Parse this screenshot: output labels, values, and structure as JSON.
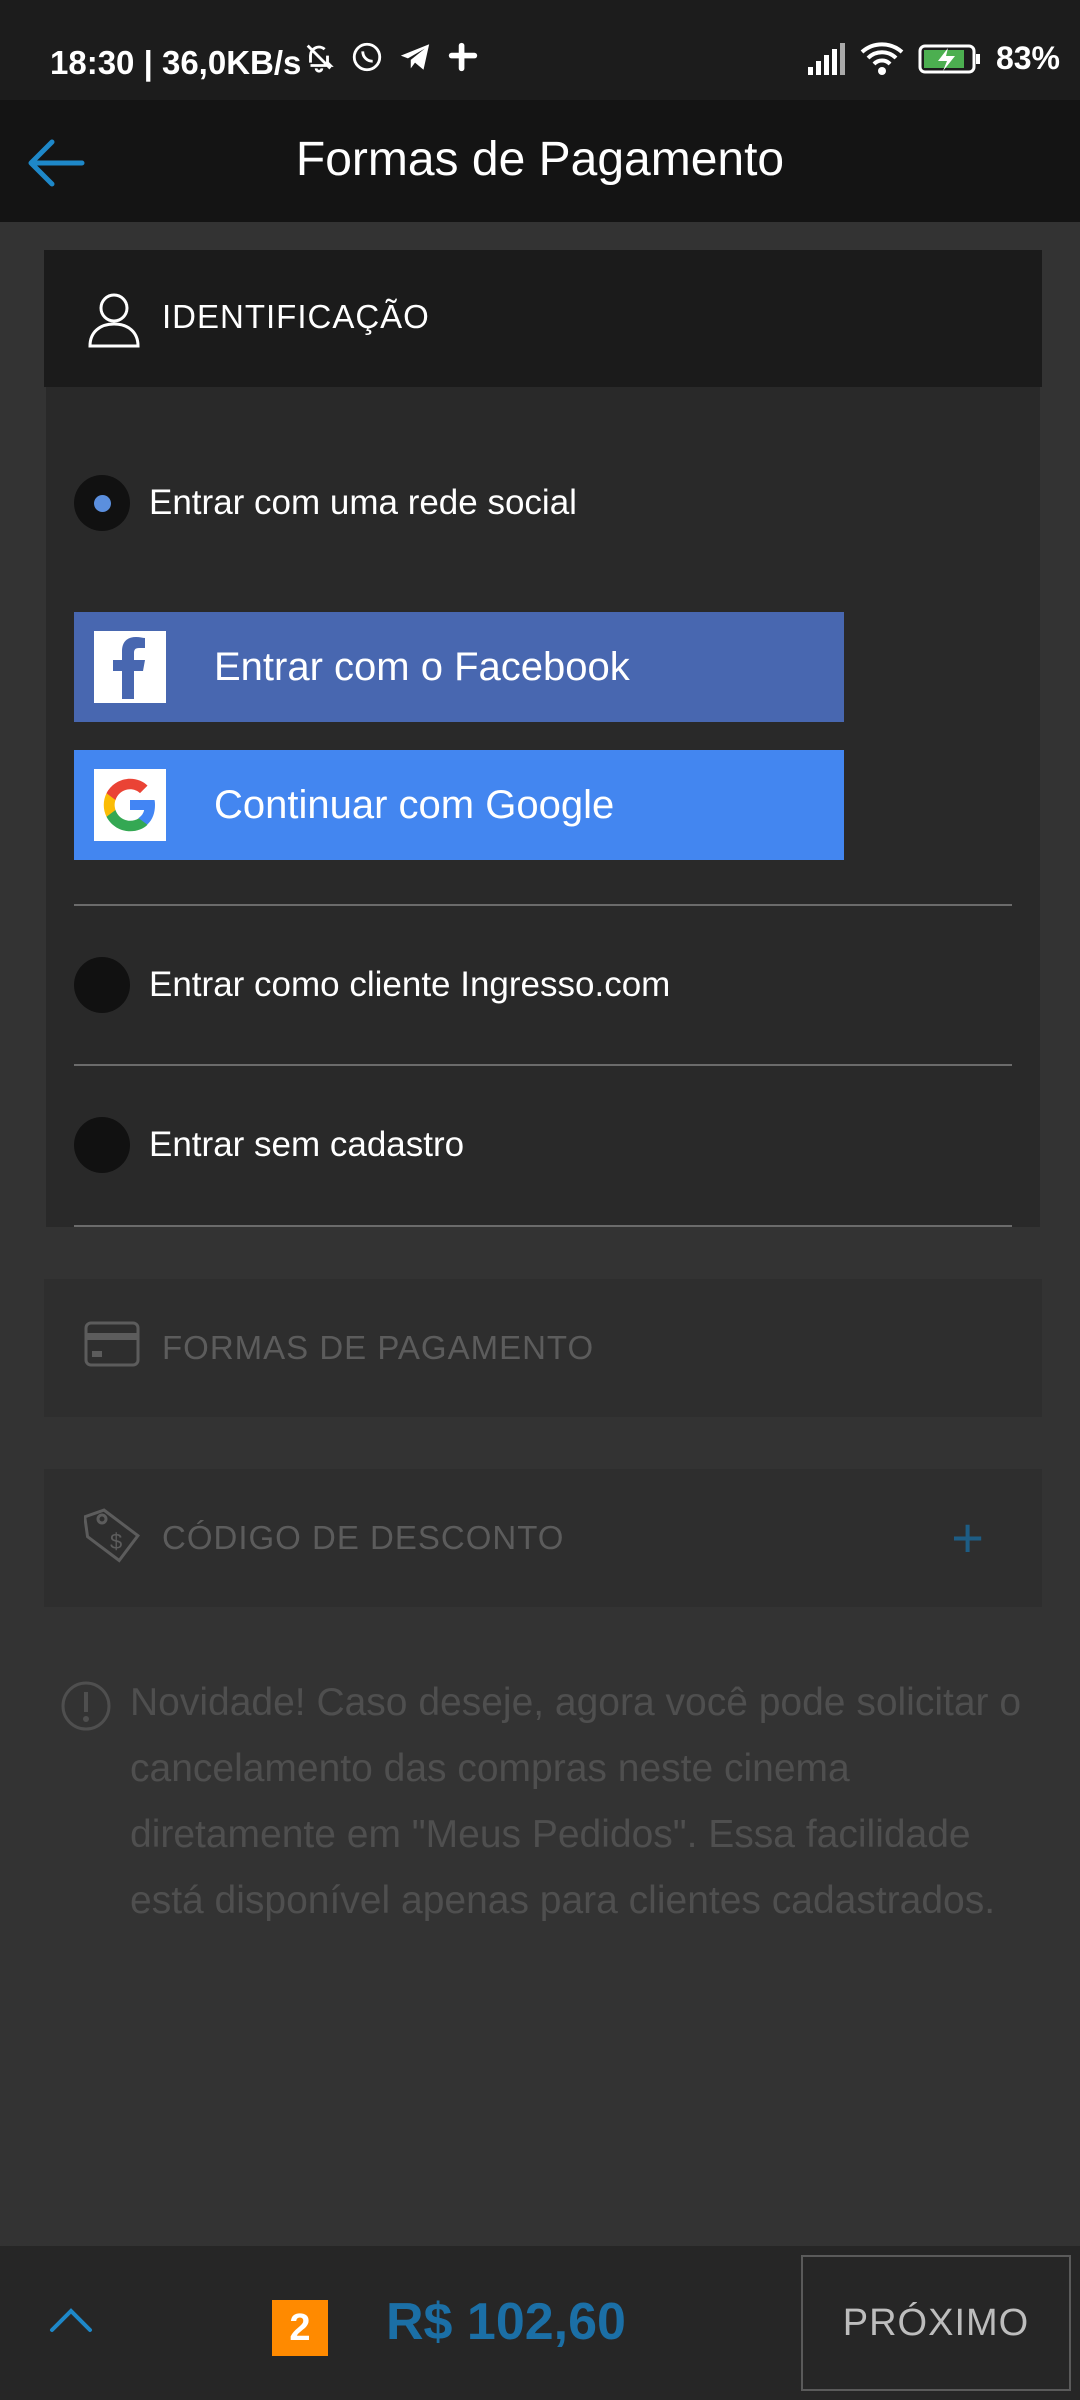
{
  "status_bar": {
    "time": "18:30",
    "speed": "| 36,0KB/s",
    "battery": "83%",
    "icons": [
      "bell-off-icon",
      "whatsapp-icon",
      "telegram-icon",
      "slack-icon",
      "signal-icon",
      "wifi-icon",
      "battery-icon"
    ]
  },
  "app_bar": {
    "title": "Formas de Pagamento",
    "accent": "#1e88c9"
  },
  "identification": {
    "header": "IDENTIFICAÇÃO",
    "options": [
      {
        "label": "Entrar com uma rede social",
        "selected": true
      },
      {
        "label": "Entrar como cliente Ingresso.com",
        "selected": false
      },
      {
        "label": "Entrar sem cadastro",
        "selected": false
      }
    ],
    "facebook_label": "Entrar com o Facebook",
    "google_label": "Continuar com Google"
  },
  "payment": {
    "header": "FORMAS DE PAGAMENTO"
  },
  "discount": {
    "header": "CÓDIGO DE DESCONTO",
    "add": "+"
  },
  "notice": {
    "text": "Novidade! Caso deseje, agora você pode solicitar o cancelamento das compras neste cinema diretamente em \"Meus Pedidos\". Essa facilidade está disponível apenas para clientes cadastrados."
  },
  "bottom_bar": {
    "count": "2",
    "total": "R$ 102,60",
    "next": "PRÓXIMO"
  }
}
